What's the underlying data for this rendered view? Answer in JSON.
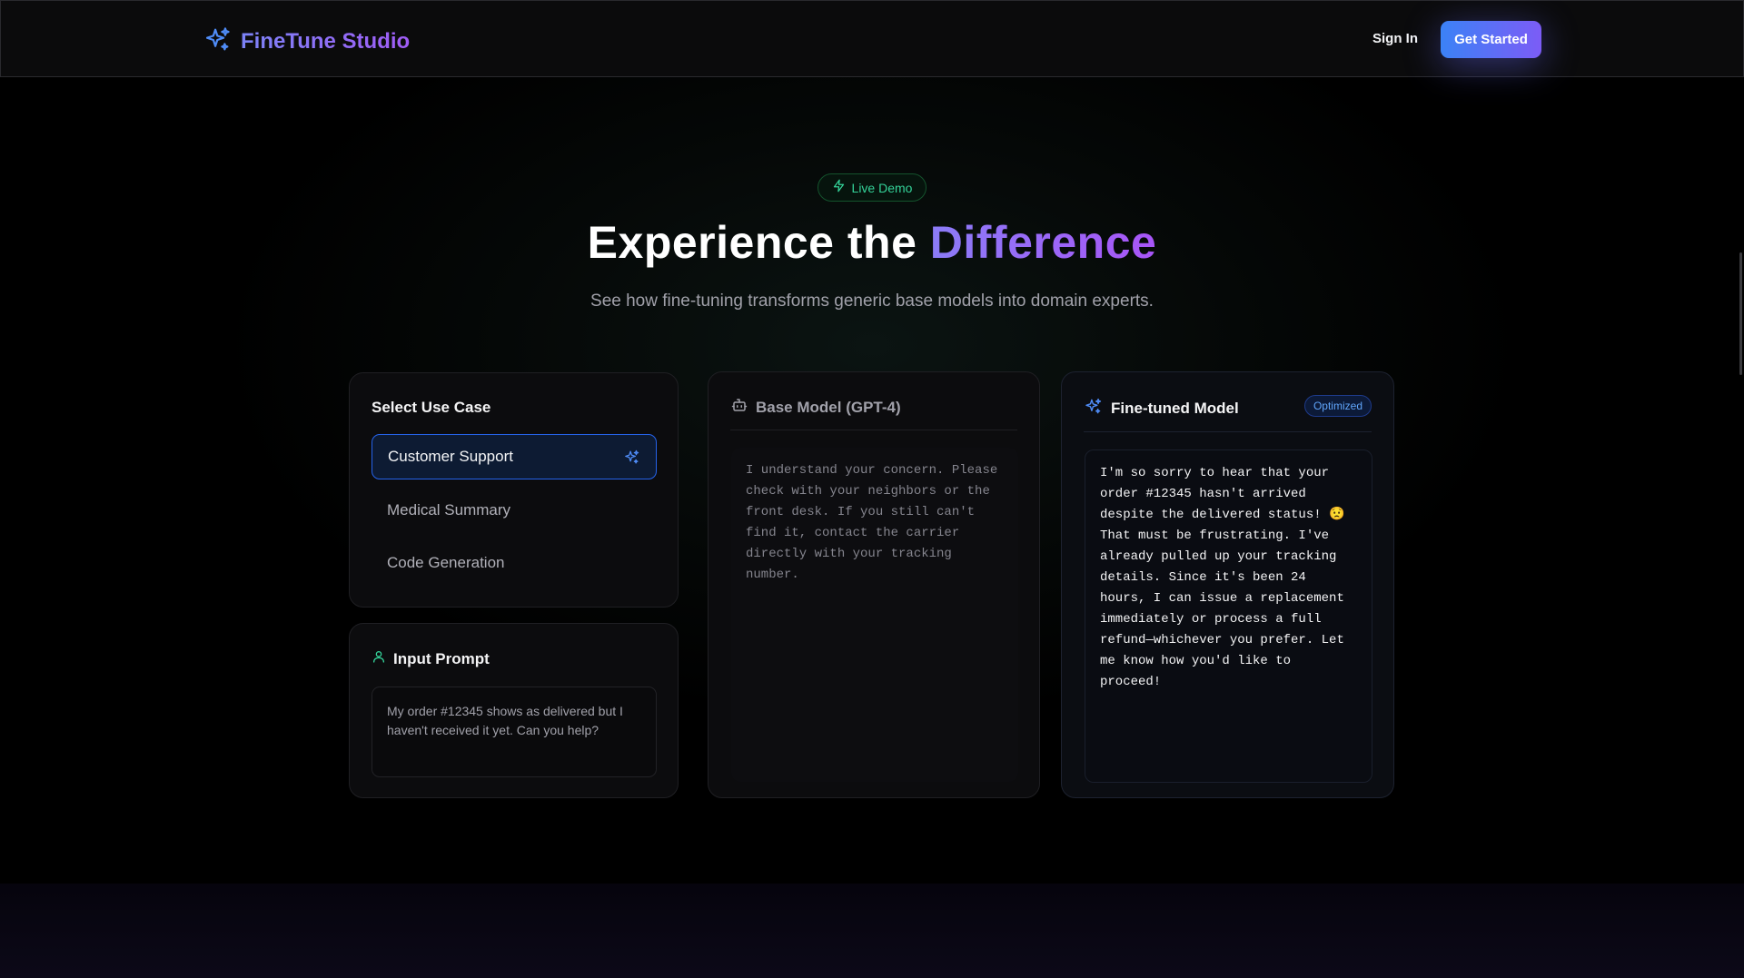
{
  "nav": {
    "brand": "FineTune Studio",
    "sign_in": "Sign In",
    "get_started": "Get Started"
  },
  "hero": {
    "pill": "Live Demo",
    "headline_main": "Experience the ",
    "headline_accent": "Difference",
    "subtitle": "See how fine-tuning transforms generic base models into domain experts."
  },
  "use_case": {
    "title": "Select Use Case",
    "items": [
      {
        "label": "Customer Support",
        "active": true
      },
      {
        "label": "Medical Summary",
        "active": false
      },
      {
        "label": "Code Generation",
        "active": false
      }
    ]
  },
  "input_prompt": {
    "title": "Input Prompt",
    "text": "My order #12345 shows as delivered but I haven't received it yet. Can you help?"
  },
  "base_model": {
    "title": "Base Model (GPT-4)",
    "response": "I understand your concern. Please\ncheck with your neighbors or the\nfront desk. If you still can't\nfind it, contact the carrier\ndirectly with your tracking\nnumber."
  },
  "fine_tuned": {
    "title": "Fine-tuned Model",
    "badge": "Optimized",
    "response": "I'm so sorry to hear that your\norder #12345 hasn't arrived\ndespite the delivered status! 😟\nThat must be frustrating. I've\nalready pulled up your tracking\ndetails. Since it's been 24\nhours, I can issue a replacement\nimmediately or process a full\nrefund—whichever you prefer. Let\nme know how you'd like to\nproceed!"
  },
  "colors": {
    "accent_blue": "#3b82f6",
    "accent_purple": "#8b5cf6",
    "live_green": "#34d399"
  }
}
